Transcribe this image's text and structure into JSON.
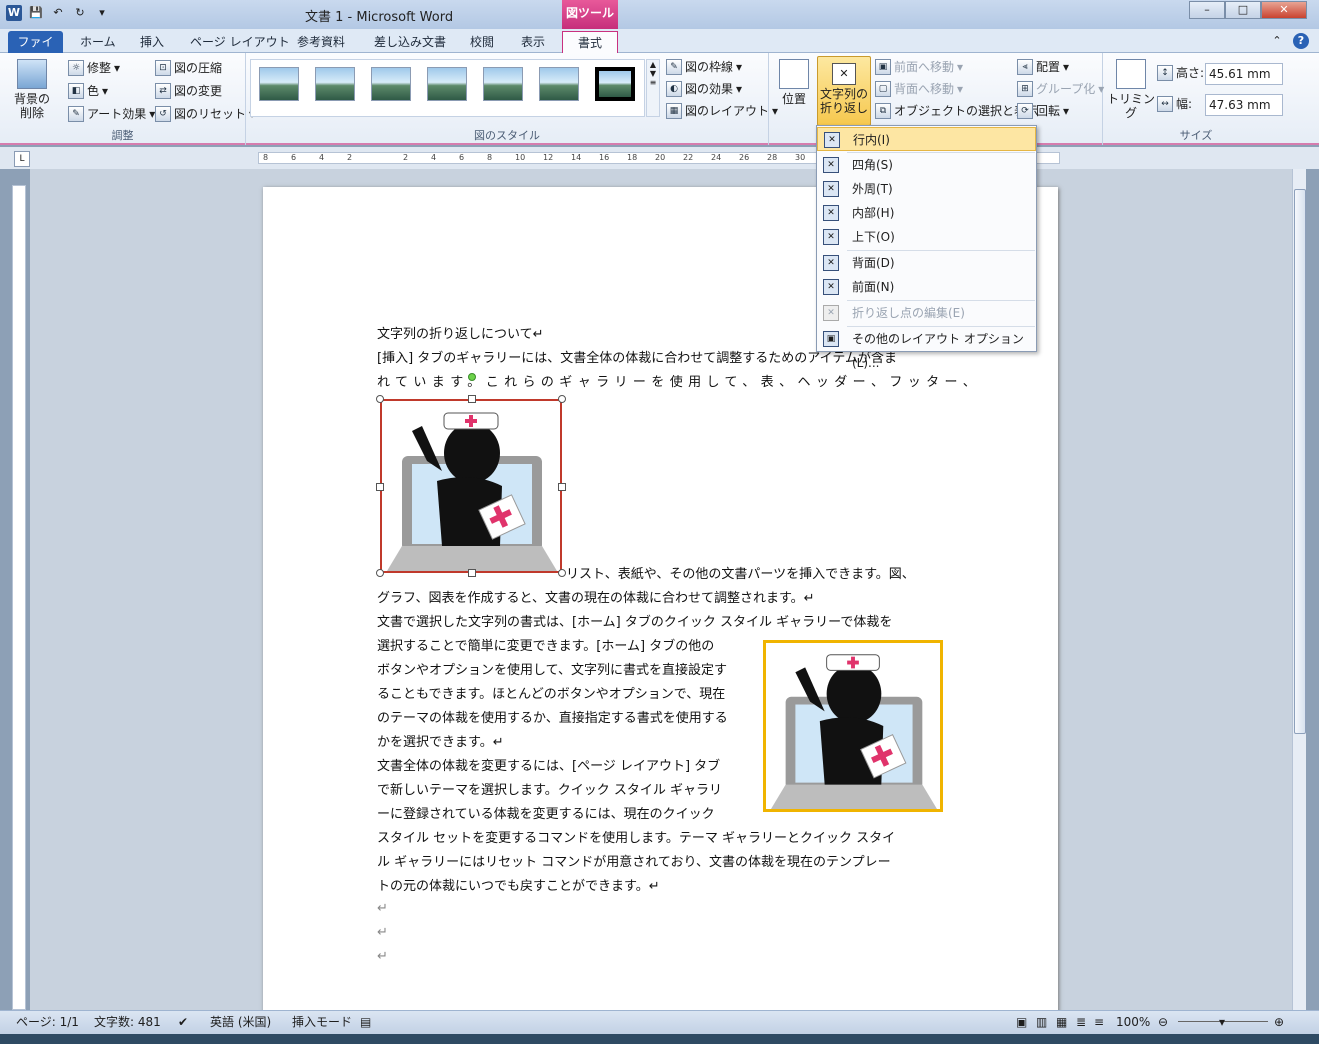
{
  "title": "文書 1 - Microsoft Word",
  "context_tab": "図ツール",
  "tabs": [
    "ファイル",
    "ホーム",
    "挿入",
    "ページ レイアウト",
    "参考資料",
    "差し込み文書",
    "校閲",
    "表示",
    "書式"
  ],
  "ribbon": {
    "adjust": {
      "remove_bg": "背景の削除",
      "corrections": "修整",
      "color": "色",
      "artistic": "アート効果",
      "compress": "図の圧縮",
      "change": "図の変更",
      "reset": "図のリセット",
      "label": "調整"
    },
    "styles": {
      "border": "図の枠線",
      "effects": "図の効果",
      "layout": "図のレイアウト",
      "label": "図のスタイル"
    },
    "arrange": {
      "position": "位置",
      "wrap": "文字列の折り返し",
      "forward": "前面へ移動",
      "backward": "背面へ移動",
      "selection": "オブジェクトの選択と表示",
      "align": "配置",
      "group": "グループ化",
      "rotate": "回転"
    },
    "size": {
      "crop": "トリミング",
      "height_label": "高さ:",
      "height": "45.61 mm",
      "width_label": "幅:",
      "width": "47.63 mm",
      "label": "サイズ"
    }
  },
  "ruler_ticks": [
    "8",
    "6",
    "4",
    "2",
    "",
    "2",
    "4",
    "6",
    "8",
    "10",
    "12",
    "14",
    "16",
    "18",
    "20",
    "22",
    "24",
    "26",
    "28",
    "30",
    "",
    "",
    "",
    "",
    "",
    "",
    "",
    "48"
  ],
  "menu": {
    "items": [
      {
        "label": "行内(I)",
        "enabled": true
      },
      {
        "label": "四角(S)",
        "enabled": true
      },
      {
        "label": "外周(T)",
        "enabled": true
      },
      {
        "label": "内部(H)",
        "enabled": true
      },
      {
        "label": "上下(O)",
        "enabled": true
      },
      {
        "label": "背面(D)",
        "enabled": true
      },
      {
        "label": "前面(N)",
        "enabled": true
      },
      {
        "label": "折り返し点の編集(E)",
        "enabled": false
      },
      {
        "label": "その他のレイアウト オプション(L)...",
        "enabled": true
      }
    ]
  },
  "doc": {
    "lines": [
      "文字列の折り返しについて↵",
      "[挿入] タブのギャラリーには、文書全体の体裁に合わせて調整するためのアイテムが含ま",
      "れています。これらのギャラリーを使用して、表、ヘッダー、フッター、",
      "リスト、表紙や、その他の文書パーツを挿入できます。図、",
      "グラフ、図表を作成すると、文書の現在の体裁に合わせて調整されます。↵",
      "文書で選択した文字列の書式は、[ホーム] タブのクイック スタイル ギャラリーで体裁を",
      "選択することで簡単に変更できます。[ホーム] タブの他の",
      "ボタンやオプションを使用して、文字列に書式を直接設定す",
      "ることもできます。ほとんどのボタンやオプションで、現在",
      "のテーマの体裁を使用するか、直接指定する書式を使用する",
      "かを選択できます。↵",
      "文書全体の体裁を変更するには、[ページ レイアウト] タブ",
      "で新しいテーマを選択します。クイック スタイル ギャラリ",
      "ーに登録されている体裁を変更するには、現在のクイック",
      "スタイル セットを変更するコマンドを使用します。テーマ ギャラリーとクイック スタイ",
      "ル ギャラリーにはリセット コマンドが用意されており、文書の体裁を現在のテンプレー",
      "トの元の体裁にいつでも戻すことができます。↵",
      "↵",
      "↵",
      "↵"
    ]
  },
  "status": {
    "page": "ページ: 1/1",
    "words": "文字数: 481",
    "lang": "英語 (米国)",
    "mode": "挿入モード",
    "zoom": "100%"
  }
}
